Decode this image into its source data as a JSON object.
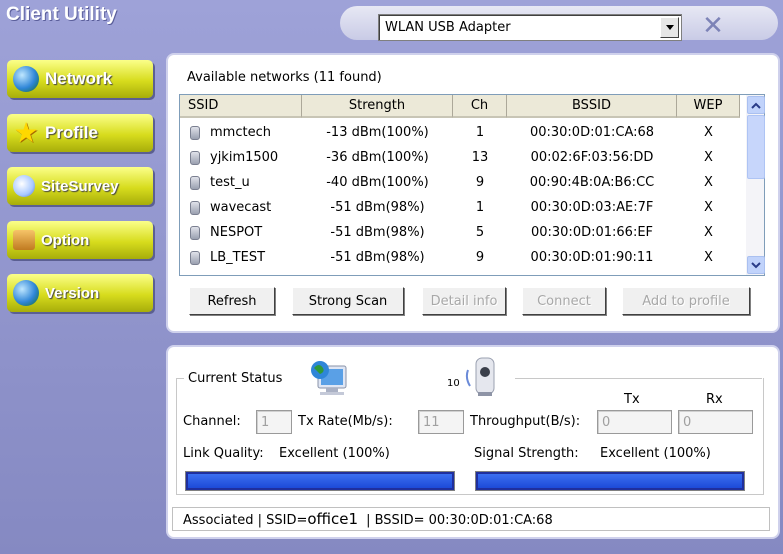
{
  "app": {
    "title": "Client Utility",
    "adapter": "WLAN USB Adapter"
  },
  "nav": [
    {
      "label": "Network",
      "icon": "globe-icon"
    },
    {
      "label": "Profile",
      "icon": "star-icon"
    },
    {
      "label": "SiteSurvey",
      "icon": "magnifier-icon"
    },
    {
      "label": "Option",
      "icon": "toolbox-icon"
    },
    {
      "label": "Version",
      "icon": "globe-icon"
    }
  ],
  "networks": {
    "header": "Available networks  (11 found)",
    "columns": [
      "SSID",
      "Strength",
      "Ch",
      "BSSID",
      "WEP"
    ],
    "rows": [
      {
        "ssid": "mmctech",
        "strength": "-13 dBm(100%)",
        "ch": "1",
        "bssid": "00:30:0D:01:CA:68",
        "wep": "X"
      },
      {
        "ssid": "yjkim1500",
        "strength": "-36 dBm(100%)",
        "ch": "13",
        "bssid": "00:02:6F:03:56:DD",
        "wep": "X"
      },
      {
        "ssid": "test_u",
        "strength": "-40 dBm(100%)",
        "ch": "9",
        "bssid": "00:90:4B:0A:B6:CC",
        "wep": "X"
      },
      {
        "ssid": "wavecast",
        "strength": "-51 dBm(98%)",
        "ch": "1",
        "bssid": "00:30:0D:03:AE:7F",
        "wep": "X"
      },
      {
        "ssid": "NESPOT",
        "strength": "-51 dBm(98%)",
        "ch": "5",
        "bssid": "00:30:0D:01:66:EF",
        "wep": "X"
      },
      {
        "ssid": "LB_TEST",
        "strength": "-51 dBm(98%)",
        "ch": "9",
        "bssid": "00:30:0D:01:90:11",
        "wep": "X"
      }
    ],
    "buttons": {
      "refresh": "Refresh",
      "strong_scan": "Strong Scan",
      "detail_info": "Detail info",
      "connect": "Connect",
      "add_to_profile": "Add to profile"
    }
  },
  "status": {
    "group_label": "Current Status",
    "antenna_label": "10",
    "channel_label": "Channel:",
    "channel_value": "1",
    "txrate_label": "Tx Rate(Mb/s):",
    "txrate_value": "11",
    "throughput_label": "Throughput(B/s):",
    "tx_header": "Tx",
    "rx_header": "Rx",
    "tx_value": "0",
    "rx_value": "0",
    "link_quality_label": "Link Quality:",
    "link_quality_value": "Excellent (100%)",
    "link_quality_fraction": 1.0,
    "signal_label": "Signal Strength:",
    "signal_value": "Excellent (100%)",
    "signal_fraction": 1.0,
    "bar_text_associated": "Associated | SSID=",
    "bar_ssid": "office1",
    "bar_bssid": "| BSSID= 00:30:0D:01:CA:68"
  },
  "colors": {
    "background": "#8a8fc6",
    "nav_button": "#d7dc1d",
    "progress": "#1d4ad8"
  }
}
